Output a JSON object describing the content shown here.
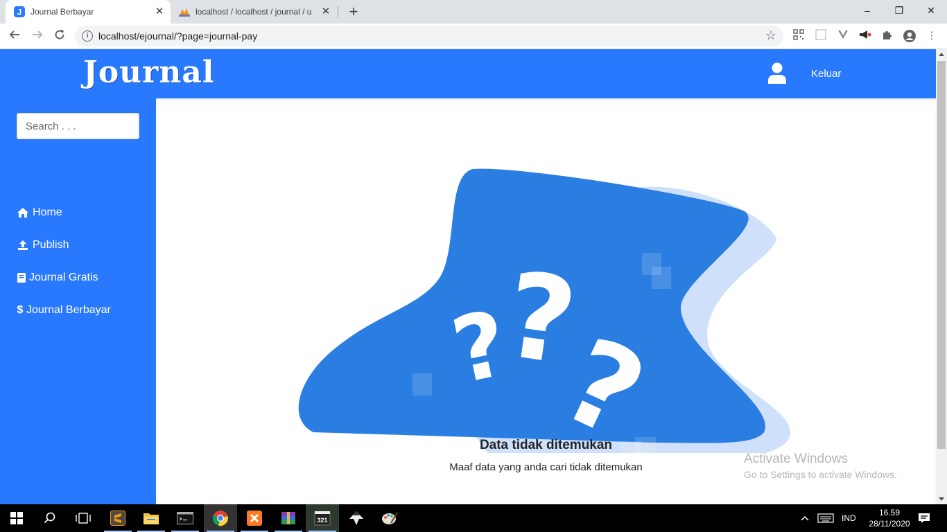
{
  "browser": {
    "tabs": [
      {
        "title": "Journal Berbayar",
        "active": true
      },
      {
        "title": "localhost / localhost / journal / u",
        "active": false
      }
    ],
    "new_tab": "+",
    "url": "localhost/ejournal/?page=journal-pay",
    "window_controls": {
      "minimize": "–",
      "restore": "❐",
      "close": "✕"
    }
  },
  "header": {
    "logo": "Journal",
    "logout_label": "Keluar"
  },
  "sidebar": {
    "search_placeholder": "Search . . .",
    "items": [
      {
        "label": "Home",
        "icon": "home-icon"
      },
      {
        "label": "Publish",
        "icon": "upload-icon"
      },
      {
        "label": "Journal Gratis",
        "icon": "book-icon"
      },
      {
        "label": "Journal Berbayar",
        "icon": "dollar-icon"
      }
    ]
  },
  "main": {
    "empty_title": "Data tidak ditemukan",
    "empty_subtitle": "Maaf data yang anda cari tidak ditemukan"
  },
  "watermark": {
    "line1": "Activate Windows",
    "line2": "Go to Settings to activate Windows."
  },
  "taskbar": {
    "language": "IND",
    "time": "16.59",
    "date": "28/11/2020"
  },
  "colors": {
    "brand": "#2979ff",
    "illustration": "#2a7de1",
    "illustration_light": "#cfe0fa"
  }
}
